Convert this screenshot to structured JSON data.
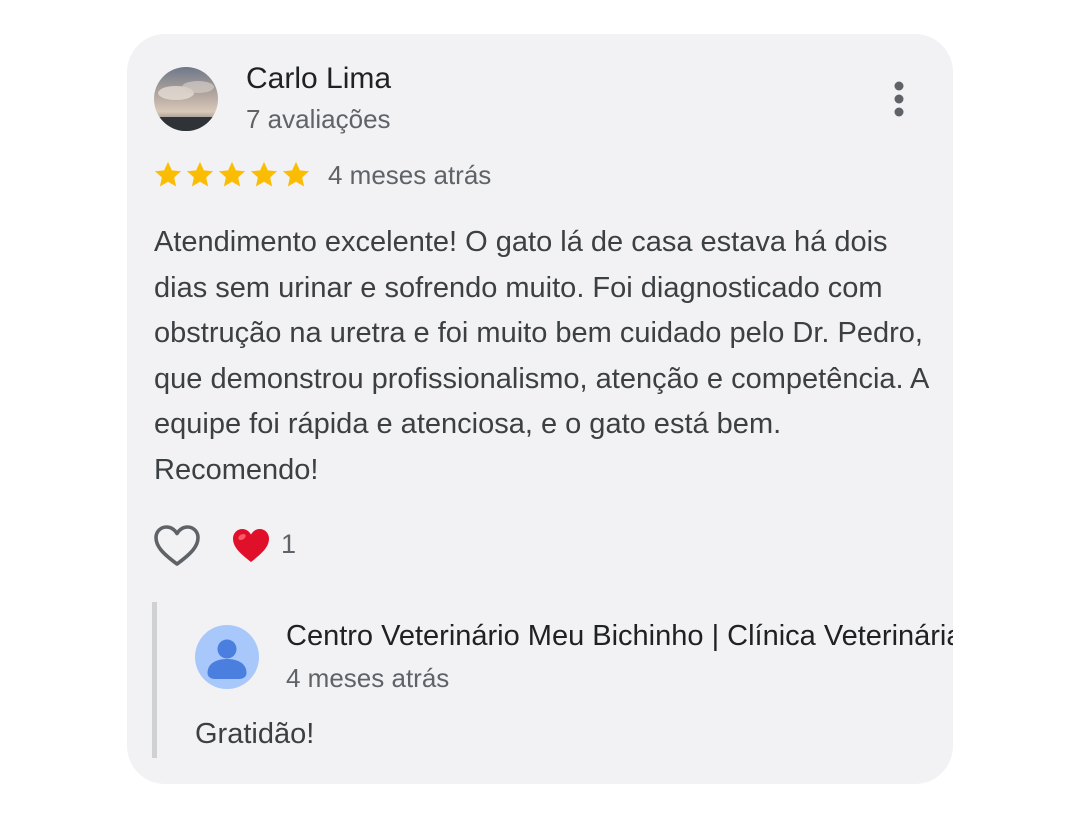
{
  "review": {
    "author": "Carlo Lima",
    "review_count": "7 avaliações",
    "rating": 5,
    "rating_max": 5,
    "time_ago": "4 meses atrás",
    "text": "Atendimento excelente! O gato lá de casa estava há dois dias sem urinar e sofrendo muito. Foi diagnosticado com obstrução na uretra e foi muito bem cuidado pelo Dr. Pedro, que demonstrou profissionalismo, atenção e competência. A equipe foi rápida e atenciosa, e o gato está bem. Recomendo!",
    "likes": "1",
    "icons": {
      "menu": "more-vert-icon",
      "star": "star-icon",
      "like": "heart-outline-icon",
      "reaction": "red-heart-icon"
    }
  },
  "reply": {
    "author": "Centro Veterinário Meu Bichinho | Clínica Veterinária",
    "time_ago": "4 meses atrás",
    "text": "Gratidão!",
    "icons": {
      "avatar": "default-profile-icon"
    }
  },
  "colors": {
    "card_bg": "#f2f2f4",
    "star": "#fbbc04",
    "heart": "#e0102b",
    "avatar_blue": "#a8c7fa",
    "avatar_figure": "#4a7fe0"
  }
}
